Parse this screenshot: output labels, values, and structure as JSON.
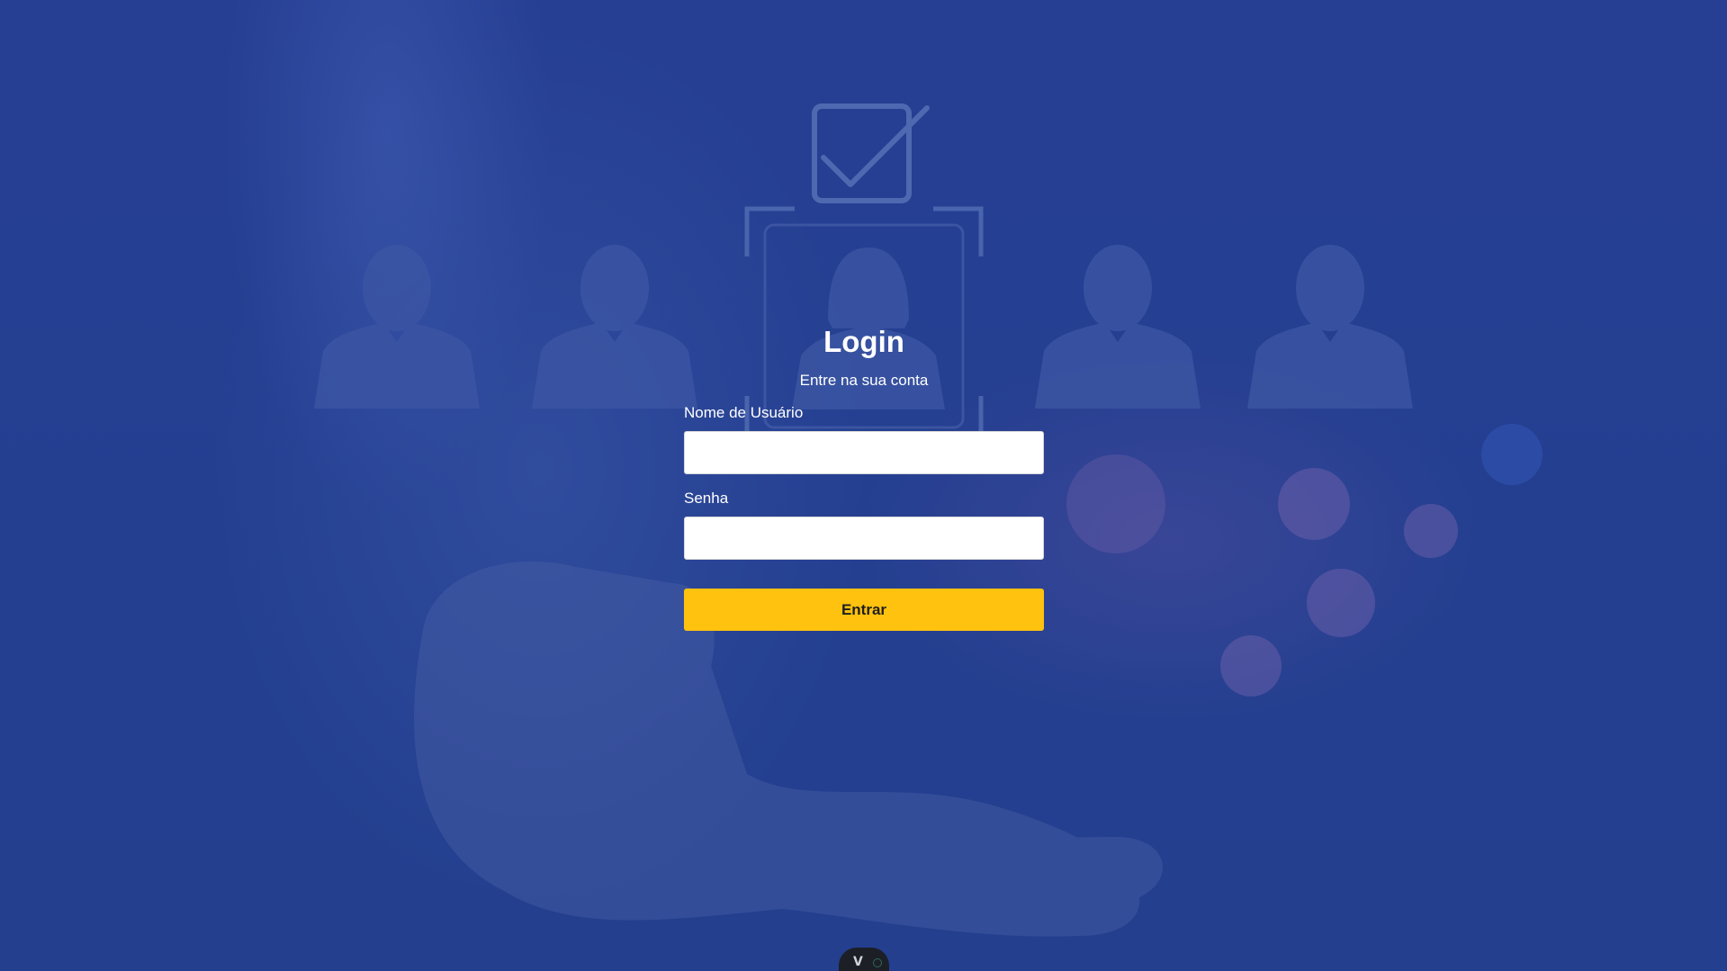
{
  "login": {
    "title": "Login",
    "subtitle": "Entre na sua conta",
    "username_label": "Nome de Usuário",
    "username_value": "",
    "password_label": "Senha",
    "password_value": "",
    "submit_label": "Entrar"
  },
  "devtools": {
    "icon": "vue-devtools-icon",
    "glyph": "V"
  },
  "colors": {
    "background": "#23408f",
    "button": "#ffc20e",
    "text": "#ffffff"
  }
}
